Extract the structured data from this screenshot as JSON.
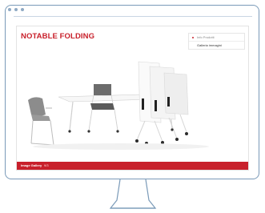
{
  "product": {
    "title": "NOTABLE FOLDING"
  },
  "menu": {
    "items": [
      {
        "label": "Info Prodotti",
        "active": true
      },
      {
        "label": "Galleria immagini",
        "active": false
      }
    ]
  },
  "footer": {
    "label": "Image Gallery",
    "count": "9/3"
  },
  "colors": {
    "brand_red": "#c8202b",
    "frame": "#7a9ab8"
  }
}
